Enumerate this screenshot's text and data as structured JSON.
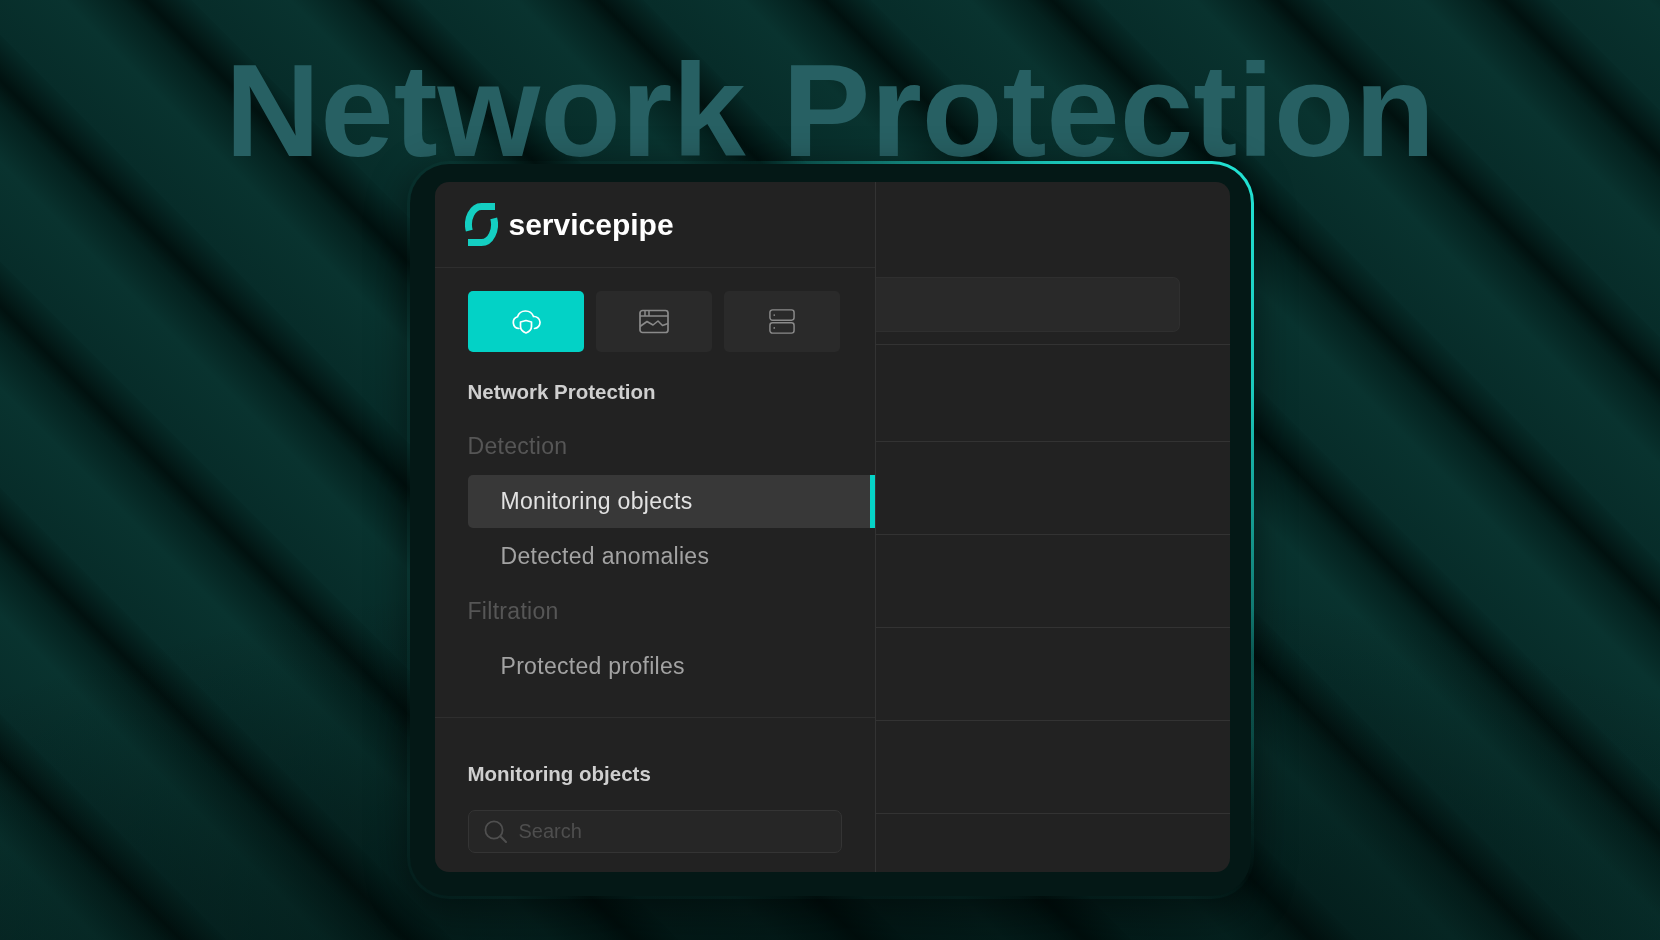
{
  "headline": "Network Protection",
  "brand": "servicepipe",
  "tabs": [
    {
      "selected": true
    },
    {
      "selected": false
    },
    {
      "selected": false
    }
  ],
  "sidebar": {
    "section_title": "Network Protection",
    "groups": [
      {
        "label": "Detection",
        "items": [
          {
            "label": "Monitoring objects",
            "selected": true
          },
          {
            "label": "Detected anomalies",
            "selected": false
          }
        ]
      },
      {
        "label": "Filtration",
        "items": [
          {
            "label": "Protected profiles",
            "selected": false
          }
        ]
      }
    ]
  },
  "list_panel": {
    "title": "Monitoring objects",
    "search": {
      "placeholder": "Search"
    }
  }
}
